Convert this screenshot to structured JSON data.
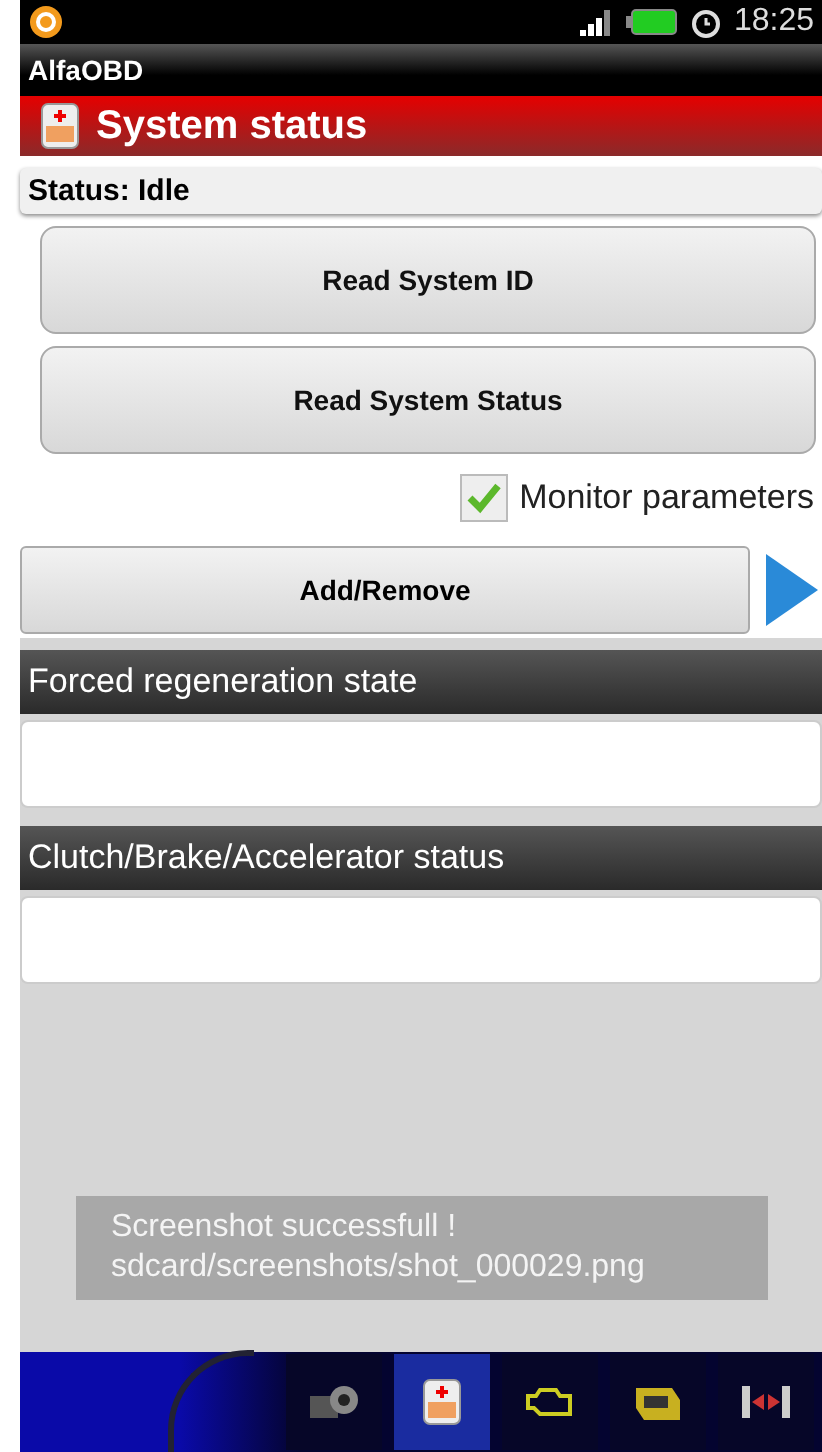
{
  "status_bar": {
    "time": "18:25"
  },
  "app_title": "AlfaOBD",
  "header": {
    "title": "System status"
  },
  "status_line": "Status: Idle",
  "buttons": [
    "Read System ID",
    "Read System Status"
  ],
  "monitor": {
    "label": "Monitor parameters",
    "checked": true
  },
  "add_remove": "Add/Remove",
  "sections": [
    {
      "title": "Forced regeneration state"
    },
    {
      "title": "Clutch/Brake/Accelerator status"
    }
  ],
  "toast": {
    "lines": [
      "Screenshot successfull  !",
      "sdcard/screenshots/shot_000029.png"
    ]
  },
  "dock": [
    {
      "kind": "camera",
      "selected": false
    },
    {
      "kind": "module",
      "selected": true
    },
    {
      "kind": "engine",
      "selected": false
    },
    {
      "kind": "gearbox",
      "selected": false
    },
    {
      "kind": "brakes",
      "selected": false
    }
  ]
}
